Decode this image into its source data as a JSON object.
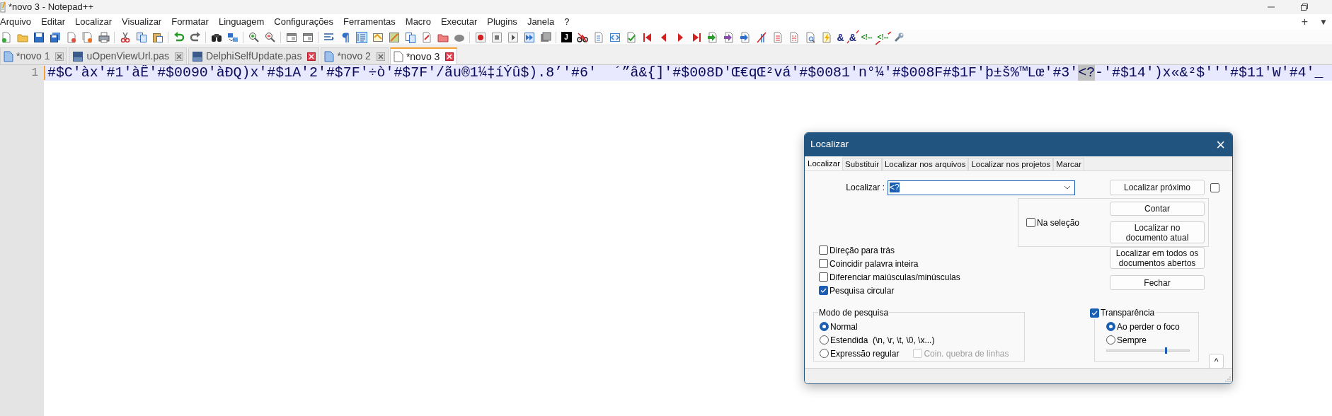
{
  "window": {
    "title": "*novo 3 - Notepad++"
  },
  "menu": [
    "Arquivo",
    "Editar",
    "Localizar",
    "Visualizar",
    "Formatar",
    "Linguagem",
    "Configurações",
    "Ferramentas",
    "Macro",
    "Executar",
    "Plugins",
    "Janela",
    "?"
  ],
  "tab_bar_controls": [
    "+",
    "▼"
  ],
  "toolbar_glyphs": [
    {
      "text": "J",
      "crossed": false
    },
    {
      "text": "&",
      "crossed": false
    },
    {
      "text": "&",
      "crossed": true
    },
    {
      "text": "<!--",
      "crossed": false
    },
    {
      "text": "<!--",
      "crossed": true
    }
  ],
  "tabs": [
    {
      "label": "*novo 1",
      "kind": "new",
      "selected": false,
      "close_highlighted": false
    },
    {
      "label": "uOpenViewUrl.pas",
      "kind": "pas",
      "selected": false,
      "close_highlighted": false
    },
    {
      "label": "DelphiSelfUpdate.pas",
      "kind": "pas",
      "selected": false,
      "close_highlighted": true
    },
    {
      "label": "*novo 2",
      "kind": "new",
      "selected": false,
      "close_highlighted": false
    },
    {
      "label": "*novo 3",
      "kind": "new",
      "selected": true,
      "close_highlighted": true
    }
  ],
  "editor": {
    "line_number": "1",
    "segments": [
      {
        "text": "#$C'àx'#1'àÊ'#$0090'àÐQ)x'#$1A'2'#$7F'÷ò'#$7F'/ãu®1¼‡íÝû$).8’'#6'  ´”â&{]'#$008D'Œ€qŒ²vá'#$0081'n°¼'#$008F#$1F'þ±š%™Lœ'#3'",
        "highlighted": false
      },
      {
        "text": "<?",
        "highlighted": true
      },
      {
        "text": "-'#$14')x«&²$'''#$11'W'#4'_",
        "highlighted": false
      }
    ]
  },
  "dialog": {
    "title": "Localizar",
    "close": "×",
    "tabs": [
      {
        "label": "Localizar",
        "selected": true
      },
      {
        "label": "Substituir",
        "selected": false
      },
      {
        "label": "Localizar nos arquivos",
        "selected": false
      },
      {
        "label": "Localizar nos projetos",
        "selected": false
      },
      {
        "label": "Marcar",
        "selected": false
      }
    ],
    "find_label": "Localizar :",
    "find_value": "<?",
    "find_next_button": "Localizar próximo",
    "side_checkbox": {
      "checked": false
    },
    "in_selection": {
      "label": "Na seleção",
      "checked": false
    },
    "count_button": "Contar",
    "find_in_current_button": "Localizar no documento atual",
    "options": [
      {
        "label": "Direção para trás",
        "checked": false
      },
      {
        "label": "Coincidir palavra inteira",
        "checked": false
      },
      {
        "label": "Diferenciar maiúsculas/minúsculas",
        "checked": false
      },
      {
        "label": "Pesquisa circular",
        "checked": true
      }
    ],
    "find_in_all_button": "Localizar em todos os documentos abertos",
    "close_button": "Fechar",
    "search_mode": {
      "title": "Modo de pesquisa",
      "modes": [
        {
          "label": "Normal",
          "selected": true
        },
        {
          "label": "Estendida  (\\n, \\r, \\t, \\0, \\x...)",
          "selected": false
        },
        {
          "label": "Expressão regular",
          "selected": false
        }
      ],
      "dot_matches_newline": {
        "label": "Coin. quebra de linhas",
        "checked": false,
        "disabled": true
      }
    },
    "transparency": {
      "label": "Transparência",
      "checked": true,
      "modes": [
        {
          "label": "Ao perder o foco",
          "selected": true
        },
        {
          "label": "Sempre",
          "selected": false
        }
      ],
      "level": 0.72
    },
    "collapse_button": "^"
  }
}
